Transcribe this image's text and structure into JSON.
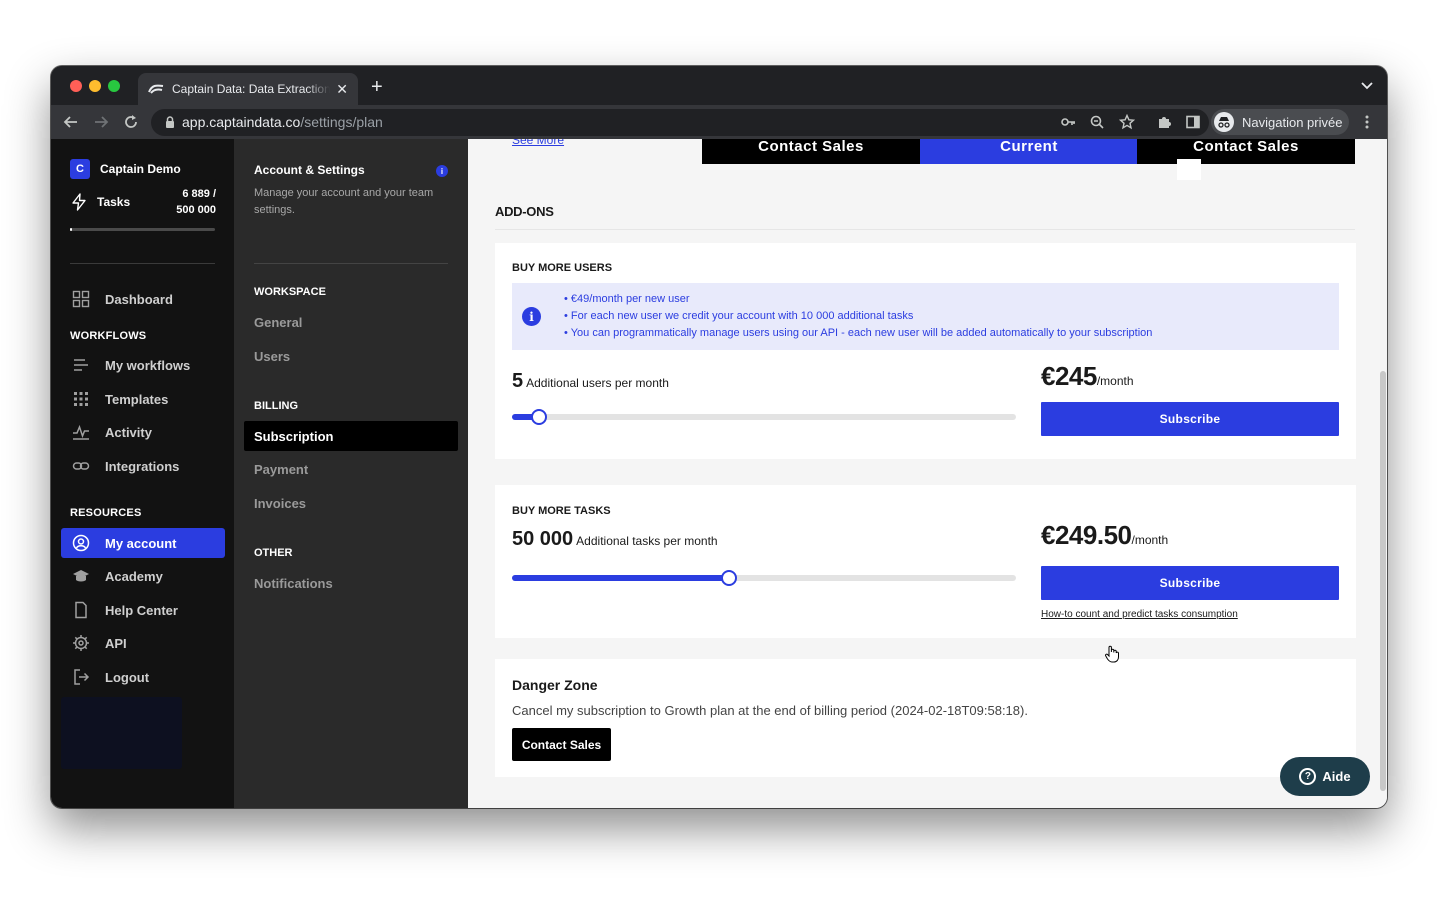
{
  "browser": {
    "tab_title": "Captain Data: Data Extraction & Automation",
    "url_host": "app.captaindata.co",
    "url_path": "/settings/plan",
    "profile_label": "Navigation privée"
  },
  "sidebar": {
    "workspace_initial": "C",
    "workspace_name": "Captain Demo",
    "tasks_label": "Tasks",
    "tasks_used": "6 889 /",
    "tasks_total": "500 000",
    "tasks_progress": 0.0138,
    "dashboard": "Dashboard",
    "workflows_section": "WORKFLOWS",
    "my_workflows": "My workflows",
    "templates": "Templates",
    "activity": "Activity",
    "integrations": "Integrations",
    "resources_section": "RESOURCES",
    "my_account": "My account",
    "academy": "Academy",
    "help_center": "Help Center",
    "api": "API",
    "logout": "Logout"
  },
  "settings": {
    "title": "Account & Settings",
    "description": "Manage your account and your team settings.",
    "workspace_section": "WORKSPACE",
    "general": "General",
    "users": "Users",
    "billing_section": "BILLING",
    "subscription": "Subscription",
    "payment": "Payment",
    "invoices": "Invoices",
    "other_section": "OTHER",
    "notifications": "Notifications"
  },
  "main": {
    "see_more": "See More",
    "plan_buttons": [
      "Contact Sales",
      "Current",
      "Contact Sales"
    ],
    "addons_title": "ADD-ONS",
    "users_card": {
      "title": "BUY MORE USERS",
      "info": [
        "• €49/month per new user",
        "• For each new user we credit your account with 10 000 additional tasks",
        "• You can programmatically manage users using our API - each new user will be added automatically to your subscription"
      ],
      "quantity": "5",
      "quantity_unit": "Additional users per month",
      "slider_fraction": 0.054,
      "price": "€245",
      "per": "/month",
      "subscribe": "Subscribe"
    },
    "tasks_card": {
      "title": "BUY MORE TASKS",
      "quantity": "50 000",
      "quantity_unit": "Additional tasks per month",
      "slider_fraction": 0.43,
      "price": "€249.50",
      "per": "/month",
      "subscribe": "Subscribe",
      "howto_link": "How-to count and predict tasks consumption"
    },
    "danger": {
      "title": "Danger Zone",
      "text": "Cancel my subscription to Growth plan at the end of billing period (2024-02-18T09:58:18).",
      "button": "Contact Sales"
    },
    "help_button": "Aide"
  },
  "colors": {
    "accent": "#2b3de0",
    "sidebar_bg": "#121212",
    "settings_bg": "#2a2a2a",
    "help_bg": "#1e3d4a"
  }
}
